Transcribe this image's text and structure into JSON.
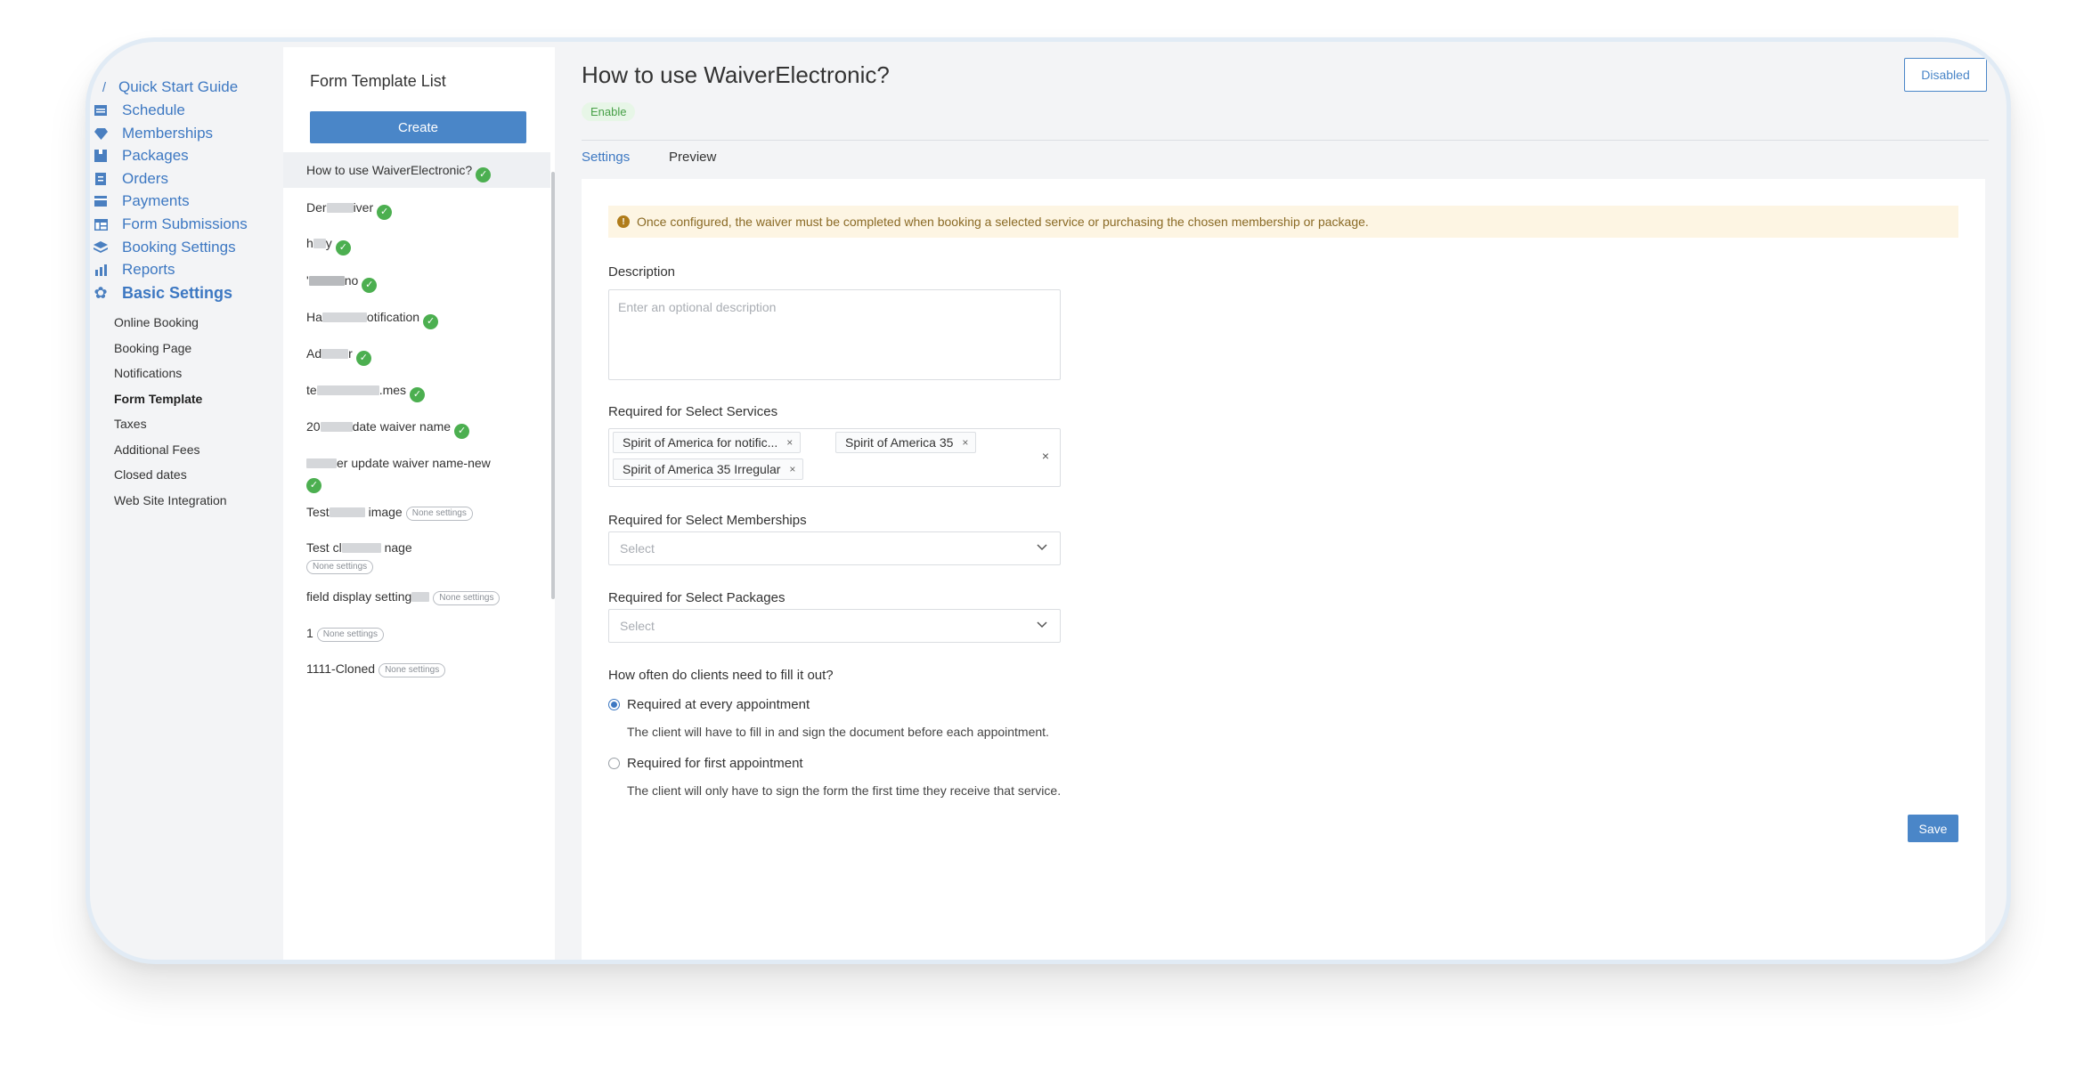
{
  "nav": {
    "items": [
      {
        "label": "Quick Start Guide",
        "icon": "pencil-icon"
      },
      {
        "label": "Schedule",
        "icon": "calendar-icon"
      },
      {
        "label": "Memberships",
        "icon": "diamond-icon"
      },
      {
        "label": "Packages",
        "icon": "package-icon"
      },
      {
        "label": "Orders",
        "icon": "orders-icon"
      },
      {
        "label": "Payments",
        "icon": "card-icon"
      },
      {
        "label": "Form Submissions",
        "icon": "table-icon"
      },
      {
        "label": "Booking Settings",
        "icon": "layers-icon"
      },
      {
        "label": "Reports",
        "icon": "bar-chart-icon"
      },
      {
        "label": "Basic Settings",
        "icon": "gear-icon"
      }
    ],
    "sub_items": [
      {
        "label": "Online Booking"
      },
      {
        "label": "Booking Page"
      },
      {
        "label": "Notifications"
      },
      {
        "label": "Form Template"
      },
      {
        "label": "Taxes"
      },
      {
        "label": "Additional Fees"
      },
      {
        "label": "Closed dates"
      },
      {
        "label": "Web Site Integration"
      }
    ],
    "active_sub": "Form Template"
  },
  "template_list": {
    "title": "Form Template List",
    "create_label": "Create",
    "none_settings_label": "None settings",
    "items": [
      {
        "text": "How to use WaiverElectronic?",
        "status": "check"
      },
      {
        "text_a": "Der",
        "text_b": "iver",
        "status": "check"
      },
      {
        "text_a": "h",
        "text_b": "y",
        "status": "check"
      },
      {
        "text_a": "'",
        "text_b": "no",
        "status": "check"
      },
      {
        "text_a": "Ha",
        "text_b": "otification",
        "status": "check"
      },
      {
        "text_a": "Ad",
        "text_b": "r",
        "status": "check"
      },
      {
        "text_a": "te",
        "text_b": ".mes",
        "status": "check"
      },
      {
        "text_a": "20",
        "text_b": "date waiver name",
        "status": "check"
      },
      {
        "text_a": "",
        "text_b": "er update waiver name-new",
        "status": "check"
      },
      {
        "text_a": "Test",
        "text_b": "image",
        "status": "none"
      },
      {
        "text_a": "Test cl",
        "text_b": "nage",
        "status": "none"
      },
      {
        "text_a": "field display setting",
        "text_b": "",
        "status": "none"
      },
      {
        "text_a": "1",
        "text_b": "",
        "status": "none"
      },
      {
        "text": "1111-Cloned",
        "status": "none"
      }
    ]
  },
  "main": {
    "title": "How to use WaiverElectronic?",
    "status_badge": "Enable",
    "toggle_label": "Disabled",
    "tabs": [
      {
        "label": "Settings"
      },
      {
        "label": "Preview"
      }
    ],
    "notice": "Once configured, the waiver must be completed when booking a selected service or purchasing the chosen membership or package.",
    "description": {
      "label": "Description",
      "placeholder": "Enter an optional description"
    },
    "services": {
      "label": "Required for Select Services",
      "tags": [
        "Spirit of America for notific...",
        "Spirit of America 35",
        "Spirit of America 35 Irregular"
      ],
      "clear": "×"
    },
    "memberships": {
      "label": "Required for Select Memberships",
      "placeholder": "Select"
    },
    "packages": {
      "label": "Required for Select Packages",
      "placeholder": "Select"
    },
    "frequency": {
      "label": "How often do clients need to fill it out?",
      "options": [
        {
          "label": "Required at every appointment",
          "desc": "The client will have to fill in and sign the document before each appointment."
        },
        {
          "label": "Required for first appointment",
          "desc": "The client will only have to sign the form the first time they receive that service."
        }
      ]
    },
    "save_label": "Save",
    "colors": {
      "accent": "#4a86c8",
      "link": "#3d78c2",
      "success": "#4caf50",
      "notice_bg": "#fdf5e3"
    }
  }
}
